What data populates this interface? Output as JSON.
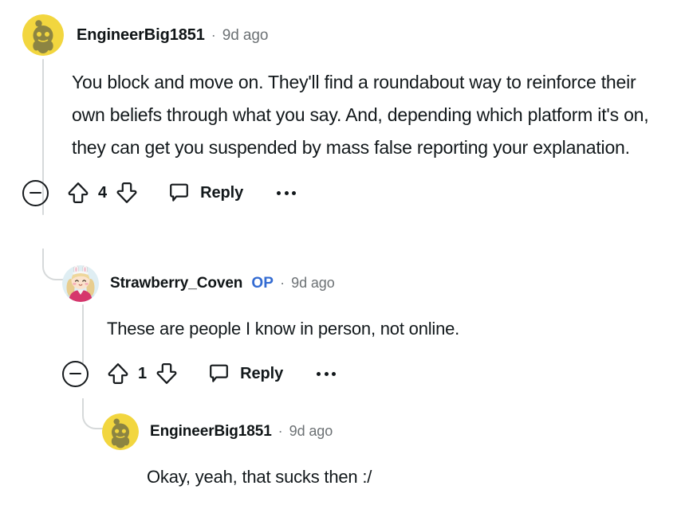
{
  "app": {
    "name": "reddit-comment-thread",
    "background": "#ffffff"
  },
  "colors": {
    "text": "#12181b",
    "username": "#0f1416",
    "timestamp": "#6c7174",
    "op_badge": "#336bd2",
    "thread_line": "#d6d9da",
    "avatar_yellow": "#f2d63f",
    "avatar_snoo": "#8c8442"
  },
  "comments": [
    {
      "depth": 0,
      "avatar": "snoo-avatar",
      "username": "EngineerBig1851",
      "op": null,
      "separator": "·",
      "timestamp": "9d ago",
      "body": "You block and move on. They'll find a roundabout way to reinforce their own beliefs through what you say. And, depending which platform it's on, they can get you suspended by mass false reporting your explanation.",
      "actions": {
        "collapse": "collapse-thread",
        "upvote": "upvote",
        "score": "4",
        "downvote": "downvote",
        "reply_label": "Reply",
        "more": "more-options"
      }
    },
    {
      "depth": 1,
      "avatar": "girl-bunny-avatar",
      "username": "Strawberry_Coven",
      "op": "OP",
      "separator": "·",
      "timestamp": "9d ago",
      "body": "These are people I know in person, not online.",
      "actions": {
        "collapse": "collapse-thread",
        "upvote": "upvote",
        "score": "1",
        "downvote": "downvote",
        "reply_label": "Reply",
        "more": "more-options"
      }
    },
    {
      "depth": 2,
      "avatar": "snoo-avatar",
      "username": "EngineerBig1851",
      "op": null,
      "separator": "·",
      "timestamp": "9d ago",
      "body": "Okay, yeah, that sucks then :/",
      "actions": null
    }
  ]
}
